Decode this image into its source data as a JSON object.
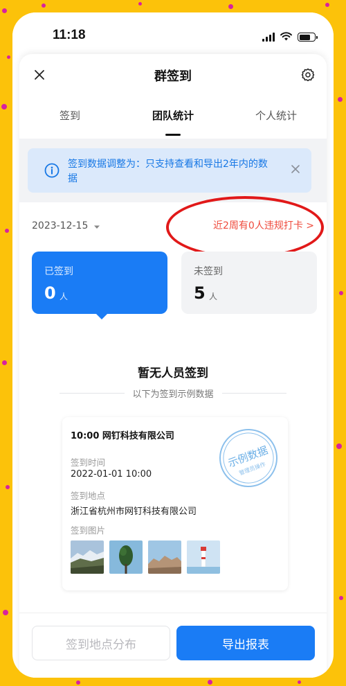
{
  "status_bar": {
    "time": "11:18"
  },
  "header": {
    "title": "群签到",
    "close_icon": "close-icon",
    "settings_icon": "gear-icon"
  },
  "tabs": [
    {
      "label": "签到",
      "active": false
    },
    {
      "label": "团队统计",
      "active": true
    },
    {
      "label": "个人统计",
      "active": false
    }
  ],
  "notice": {
    "icon": "info-icon",
    "text": "签到数据调整为：只支持查看和导出2年内的数据"
  },
  "date_filter": {
    "date": "2023-12-15",
    "icon": "caret-down-icon"
  },
  "violation_link": "近2周有0人违规打卡 >",
  "stats": {
    "signed": {
      "label": "已签到",
      "value": "0",
      "unit": "人"
    },
    "unsigned": {
      "label": "未签到",
      "value": "5",
      "unit": "人"
    }
  },
  "empty_state": {
    "title": "暂无人员签到",
    "subtitle": "以下为签到示例数据"
  },
  "example": {
    "title": "10:00 网钉科技有限公司",
    "time_label": "签到时间",
    "time_value": "2022-01-01 10:00",
    "location_label": "签到地点",
    "location_value": "浙江省杭州市网钉科技有限公司",
    "photos_label": "签到图片",
    "stamp_text": "示例数据",
    "stamp_subtext": "管理员操作"
  },
  "bottom_actions": {
    "distribution": "签到地点分布",
    "export": "导出报表"
  },
  "colors": {
    "primary": "#1a7cf5",
    "alert_red": "#ef4a3c",
    "notice_bg": "#dbe9fb",
    "background": "#fcc20a",
    "dot": "#d8229e"
  }
}
